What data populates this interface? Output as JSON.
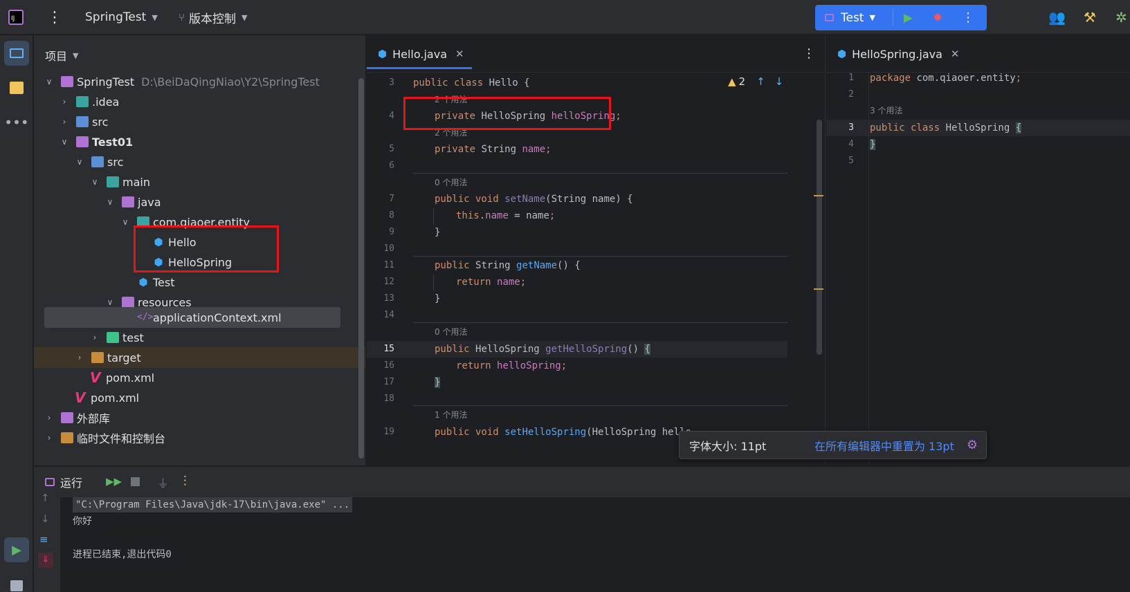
{
  "topbar": {
    "project_name": "SpringTest",
    "vcs_label": "版本控制",
    "run_config": "Test"
  },
  "project_panel": {
    "title": "项目",
    "tree": [
      {
        "label": "SpringTest",
        "path": "D:\\BeiDaQingNiao\\Y2\\SpringTest"
      },
      {
        "label": ".idea"
      },
      {
        "label": "src"
      },
      {
        "label": "Test01"
      },
      {
        "label": "src"
      },
      {
        "label": "main"
      },
      {
        "label": "java"
      },
      {
        "label": "com.qiaoer.entity"
      },
      {
        "label": "Hello"
      },
      {
        "label": "HelloSpring"
      },
      {
        "label": "Test"
      },
      {
        "label": "resources"
      },
      {
        "label": "applicationContext.xml"
      },
      {
        "label": "test"
      },
      {
        "label": "target"
      },
      {
        "label": "pom.xml"
      },
      {
        "label": "pom.xml"
      },
      {
        "label": "外部库"
      },
      {
        "label": "临时文件和控制台"
      }
    ]
  },
  "editor_left": {
    "tab": "Hello.java",
    "warning_count": "2",
    "line_numbers": [
      "3",
      "4",
      "5",
      "6",
      "7",
      "8",
      "9",
      "10",
      "11",
      "12",
      "13",
      "14",
      "15",
      "16",
      "17",
      "18",
      "19"
    ],
    "hints": [
      "2 个用法",
      "2 个用法",
      "0 个用法",
      "0 个用法",
      "1 个用法"
    ]
  },
  "editor_right": {
    "tab": "HelloSpring.java",
    "line_numbers": [
      "1",
      "2",
      "3",
      "4",
      "5"
    ],
    "hint": "3 个用法"
  },
  "font_popup": {
    "label": "字体大小: 11pt",
    "reset_link": "在所有编辑器中重置为 13pt"
  },
  "run_panel": {
    "title": "运行",
    "console": [
      "\"C:\\Program Files\\Java\\jdk-17\\bin\\java.exe\" ...",
      "你好",
      "",
      "进程已结束,退出代码0"
    ]
  },
  "colors": {
    "accent": "#3574f0",
    "highlight_box": "#e8141c",
    "keyword": "#cf8e6d",
    "field": "#c77dbb",
    "method": "#56a8f5"
  }
}
